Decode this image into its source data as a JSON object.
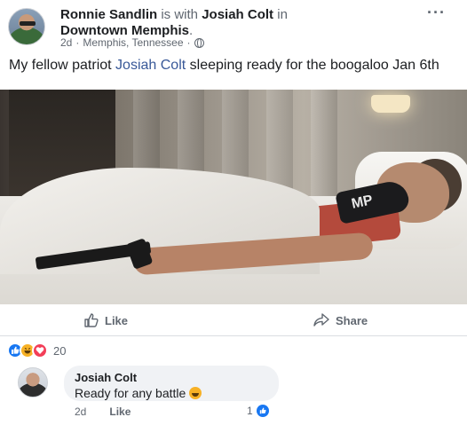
{
  "post": {
    "author": "Ronnie Sandlin",
    "with_word": "is with",
    "tagged": "Josiah Colt",
    "in_word": "in",
    "location": "Downtown Memphis",
    "location_suffix": ".",
    "time": "2d",
    "dot": "·",
    "place": "Memphis, Tennessee",
    "dot2": "·",
    "more_label": "···",
    "text_before": "My fellow patriot ",
    "text_tag": "Josiah Colt",
    "text_after": " sleeping ready for the boogaloo Jan 6th",
    "photo_mask_text": "MP"
  },
  "actions": {
    "like_label": "Like",
    "share_label": "Share"
  },
  "reactions": {
    "count": "20",
    "icons": [
      "like-icon",
      "haha-icon",
      "love-icon"
    ],
    "colors": {
      "like": "#1877f2",
      "haha": "#f7b125",
      "love": "#f33e58"
    }
  },
  "comment": {
    "author": "Josiah Colt",
    "text": "Ready for any battle",
    "time": "2d",
    "like_label": "Like",
    "like_count": "1"
  },
  "colors": {
    "link": "#385898",
    "meta_gray": "#606770",
    "bubble_bg": "#f0f2f5"
  }
}
